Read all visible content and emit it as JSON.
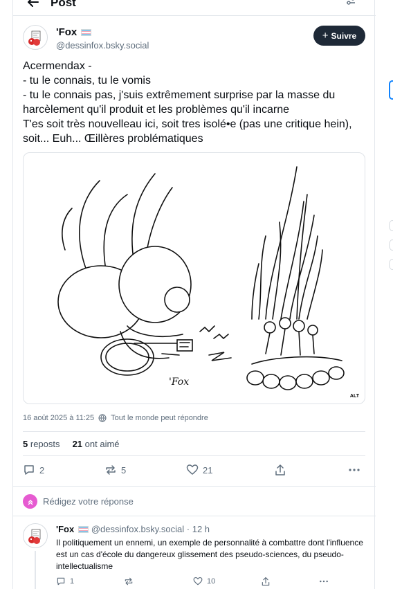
{
  "topbar": {
    "title": "Post"
  },
  "post": {
    "author_name": "'Fox",
    "author_handle": "@dessinfox.bsky.social",
    "follow_label": "Suivre",
    "text_lines": [
      "Acermendax -",
      "- tu le connais, tu le vomis",
      "- tu le connais pas, j'suis extrêmement surprise par la masse du harcèlement qu'il produit et les problèmes qu'il incarne",
      "T'es soit très nouvelleau ici, soit tres isolé•e (pas une critique hein), soit... Euh... Œillères problématiques"
    ],
    "image_alt_badge": "ALT",
    "signature": "'Fox",
    "timestamp": "16 août 2025 à 11:25",
    "reply_policy": "Tout le monde peut répondre",
    "reposts_count": "5",
    "reposts_label": "reposts",
    "likes_count": "21",
    "likes_label": "ont aimé",
    "actions": {
      "replies": "2",
      "reposts": "5",
      "likes": "21"
    }
  },
  "composer": {
    "placeholder": "Rédigez votre réponse"
  },
  "reply": {
    "author_name": "'Fox",
    "author_handle": "@dessinfox.bsky.social",
    "time": "· 12 h",
    "text": "Il politiquement un ennemi, un exemple de personnalité à combattre dont l'influence est un cas d'école du dangereux glissement des pseudo-sciences, du pseudo-intellectualisme",
    "actions": {
      "replies": "1",
      "likes": "10"
    }
  },
  "icons": [
    "back-arrow-icon",
    "settings-icon",
    "plus-icon",
    "globe-icon",
    "reply-icon",
    "repost-icon",
    "heart-icon",
    "share-icon",
    "more-icon"
  ],
  "colors": {
    "follow_bg": "#1e2937",
    "text": "#0b0f14",
    "muted": "#5f6e7d",
    "border": "#e3e7ec",
    "composer_avatar": "#e65bd1"
  }
}
